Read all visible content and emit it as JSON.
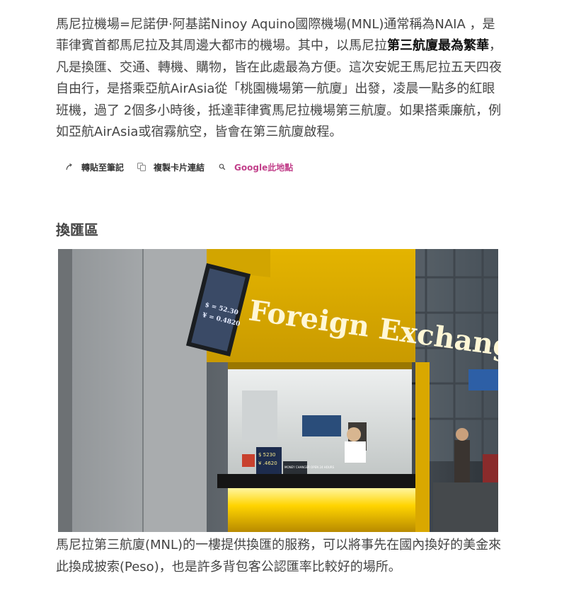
{
  "article": {
    "intro_part1": "馬尼拉機場=尼諾伊·阿基諾Ninoy Aquino國際機場(MNL)通常稱為NAIA ，是菲律賓首都馬尼拉及其周邊大都市的機場。其中，以馬尼拉",
    "intro_bold": "第三航廈最為繁華",
    "intro_part2": "，凡是換匯、交通、轉機、購物，皆在此處最為方便。這次安妮王馬尼拉五天四夜自由行，是搭乘亞航AirAsia從「桃園機場第一航廈」出發，凌晨一點多的紅眼班機，過了 2個多小時後，抵達菲律賓馬尼拉機場第三航廈。如果搭乘廉航，例如亞航AirAsia或宿霧航空，皆會在第三航廈啟程。"
  },
  "actions": {
    "save_note": {
      "label": "轉貼至筆記",
      "icon": "share-arrow-icon"
    },
    "copy_link": {
      "label": "複製卡片連結",
      "icon": "copy-icon"
    },
    "google_place": {
      "label": "Google此地點",
      "icon": "search-icon",
      "color": "#c2418b"
    }
  },
  "section": {
    "title": "換匯區"
  },
  "photo": {
    "sign": "Foreign Exchange",
    "board_rate1": "$ = 52.30",
    "board_rate2": "¥ = 0.4820",
    "counter_rate1": "$ 5230",
    "counter_rate2": "¥ .4620",
    "counter_notice": "MONEY CHANGER OPEN 24 HOURS"
  },
  "caption": {
    "text": "馬尼拉第三航廈(MNL)的一樓提供換匯的服務，可以將事先在國內換好的美金來此換成披索(Peso)，也是許多背包客公認匯率比較好的場所。"
  },
  "colors": {
    "text": "#444444",
    "accent": "#c2418b",
    "booth_yellow": "#e8b900"
  }
}
